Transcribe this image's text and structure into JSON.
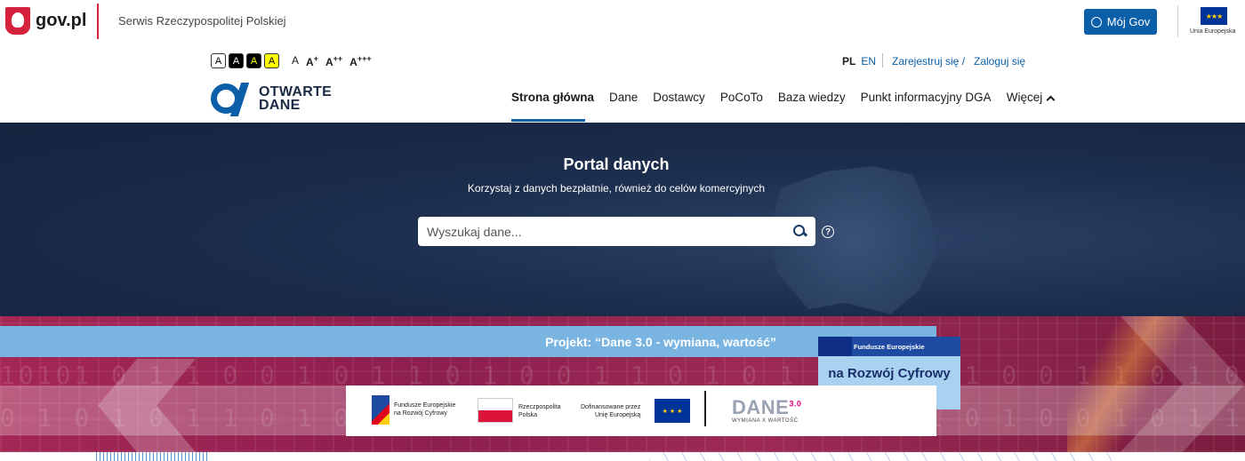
{
  "govbar": {
    "brand": "gov.pl",
    "service": "Serwis Rzeczypospolitej Polskiej",
    "moj_gov": "Mój Gov",
    "eu_label": "Unia Europejska"
  },
  "accessibility": {
    "contrast_options": [
      "A",
      "A",
      "A",
      "A"
    ],
    "font_sizes": [
      {
        "base": "A",
        "sup": ""
      },
      {
        "base": "A",
        "sup": "+"
      },
      {
        "base": "A",
        "sup": "++"
      },
      {
        "base": "A",
        "sup": "+++"
      }
    ]
  },
  "lang": {
    "pl": "PL",
    "en": "EN"
  },
  "auth": {
    "register": "Zarejestruj się /",
    "login": "Zaloguj się"
  },
  "logo": {
    "line1": "OTWARTE",
    "line2": "DANE"
  },
  "nav": {
    "items": [
      "Strona główna",
      "Dane",
      "Dostawcy",
      "PoCoTo",
      "Baza wiedzy",
      "Punkt informacyjny DGA",
      "Więcej"
    ],
    "active_index": 0
  },
  "hero": {
    "title": "Portal danych",
    "subtitle": "Korzystaj z danych bezpłatnie, również do celów komercyjnych",
    "search_placeholder": "Wyszukaj dane..."
  },
  "banner": {
    "project": "Projekt: “Dane 3.0 - wymiana, wartość”",
    "badge_top": "Fundusze Europejskie",
    "badge_main": "na Rozwój Cyfrowy",
    "logo_fe_line1": "Fundusze Europejskie",
    "logo_fe_line2": "na Rozwój Cyfrowy",
    "logo_pl_line1": "Rzeczpospolita",
    "logo_pl_line2": "Polska",
    "logo_eu_line1": "Dofinansowane przez",
    "logo_eu_line2": "Unię Europejską",
    "logo_dane": "DANE",
    "logo_dane_sup": "3.0",
    "logo_dane_sub": "WYMIANA X WARTOŚĆ"
  },
  "colors": {
    "primary": "#0b5ea8",
    "gov_red": "#d4213d",
    "hero_bg": "#1b2d4c",
    "banner_bg": "#8d1f4f"
  }
}
